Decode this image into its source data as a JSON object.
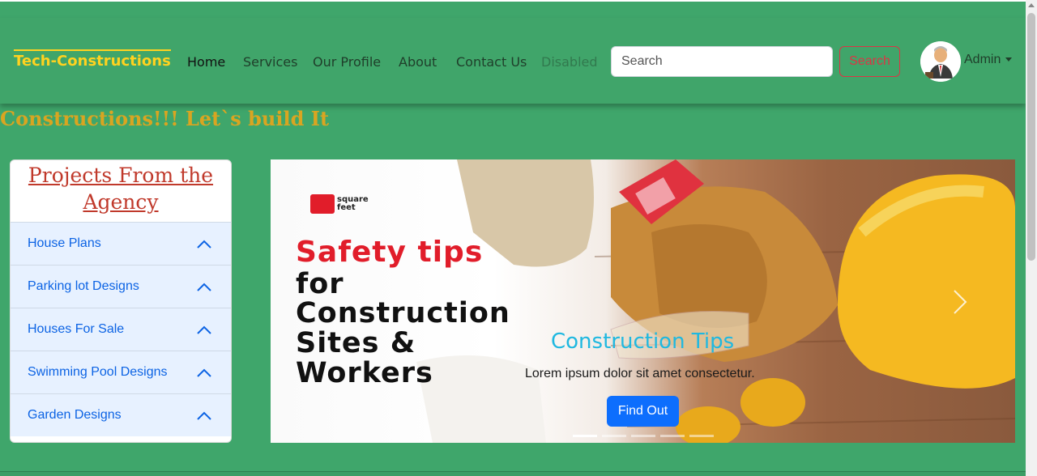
{
  "navbar": {
    "brand": "Tech-Constructions",
    "links": [
      {
        "label": "Home",
        "state": "active"
      },
      {
        "label": "Services",
        "state": "normal"
      },
      {
        "label": "Our Profile",
        "state": "normal"
      },
      {
        "label": "About",
        "state": "normal"
      },
      {
        "label": "Contact Us",
        "state": "normal"
      },
      {
        "label": "Disabled",
        "state": "disabled"
      }
    ],
    "search": {
      "placeholder": "Search",
      "button_label": "Search"
    },
    "user": {
      "name": "Admin"
    }
  },
  "marquee": {
    "text": "ch-Constructions!!! Let`s build It"
  },
  "sidebar": {
    "title": "Projects From the Agency",
    "items": [
      {
        "label": "House Plans"
      },
      {
        "label": "Parking lot Designs"
      },
      {
        "label": "Houses For Sale"
      },
      {
        "label": "Swimming Pool Designs"
      },
      {
        "label": "Garden Designs"
      }
    ]
  },
  "carousel": {
    "slide": {
      "logo_text": [
        "square",
        "feet"
      ],
      "headline_red": "Safety tips",
      "headline_lines": [
        "for",
        "Construction",
        "Sites &",
        "Workers"
      ],
      "caption_title": "Construction Tips",
      "caption_text": "Lorem ipsum dolor sit amet consectetur.",
      "button_label": "Find Out"
    },
    "slide_count": 5,
    "active_index": 0
  },
  "colors": {
    "page_bg": "#3fa66b",
    "brand": "#ffd21f",
    "marquee": "#d9a521",
    "danger": "#dc3545",
    "primary": "#0d6efd",
    "accordion_bg": "#e7f1ff",
    "caption_title": "#1fb8e0",
    "headline_red": "#e11d2a"
  }
}
